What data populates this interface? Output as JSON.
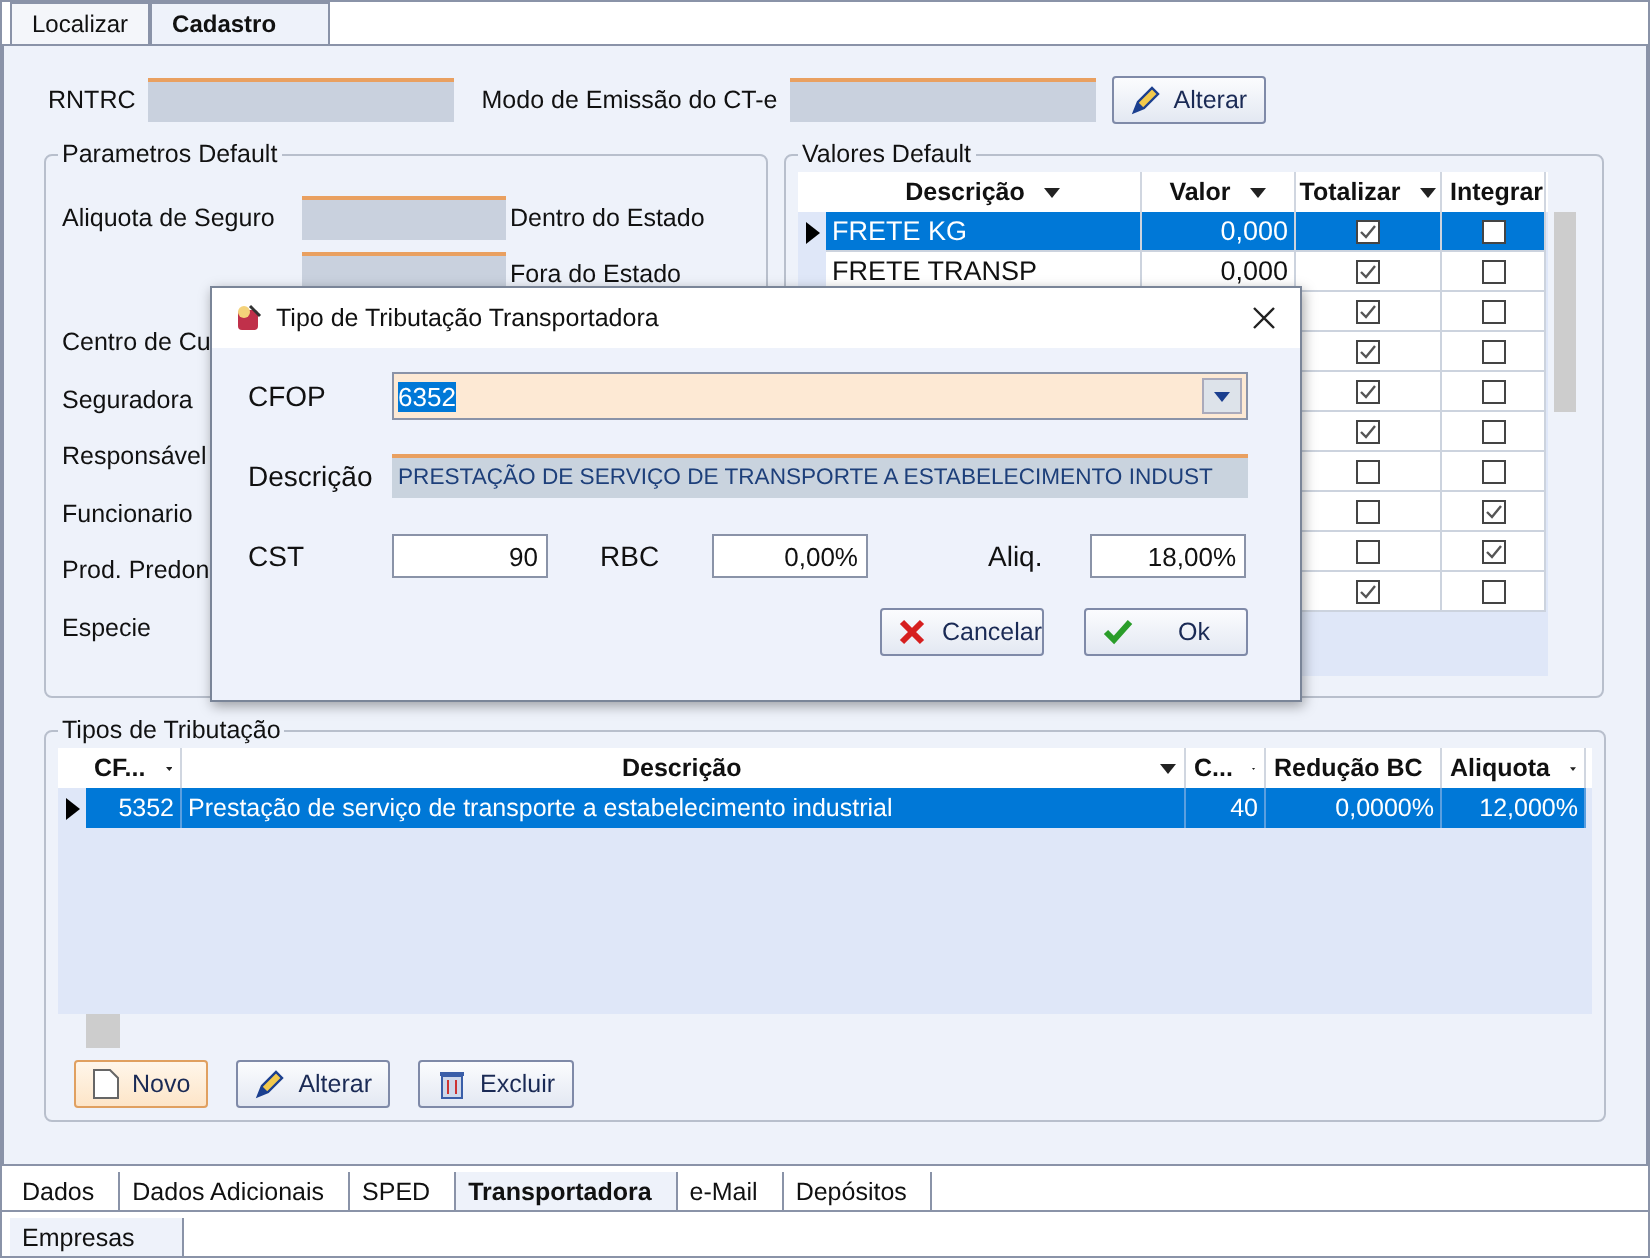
{
  "top_tabs": [
    {
      "label": "Localizar",
      "selected": false
    },
    {
      "label": "Cadastro",
      "selected": true
    }
  ],
  "header": {
    "rntrc_label": "RNTRC",
    "modo_label": "Modo de Emissão do CT-e",
    "alterar_button": "Alterar"
  },
  "parametros_default": {
    "title": "Parametros Default",
    "aliquota_label": "Aliquota de Seguro",
    "dentro_label": "Dentro do Estado",
    "fora_label": "Fora do Estado",
    "labels": [
      "Centro de Cu",
      "Seguradora",
      "Responsável",
      "Funcionario",
      "Prod. Predon",
      "Especie"
    ]
  },
  "valores_default": {
    "title": "Valores Default",
    "columns": [
      "Descrição",
      "Valor",
      "Totalizar",
      "Integrar"
    ],
    "rows": [
      {
        "descricao": "FRETE KG",
        "valor": "0,000",
        "totalizar": true,
        "integrar": false,
        "selected": true
      },
      {
        "descricao": "FRETE TRANSP",
        "valor": "0,000",
        "totalizar": true,
        "integrar": false,
        "selected": false
      },
      {
        "totalizar": true,
        "integrar": false,
        "selected": false
      },
      {
        "totalizar": true,
        "integrar": false,
        "selected": false
      },
      {
        "totalizar": true,
        "integrar": false,
        "selected": false
      },
      {
        "totalizar": true,
        "integrar": false,
        "selected": false
      },
      {
        "totalizar": false,
        "integrar": false,
        "selected": false
      },
      {
        "totalizar": false,
        "integrar": true,
        "selected": false
      },
      {
        "totalizar": false,
        "integrar": true,
        "selected": false
      },
      {
        "totalizar": true,
        "integrar": false,
        "selected": false
      }
    ]
  },
  "tipos_tributacao": {
    "title": "Tipos de Tributação",
    "columns": [
      "CF...",
      "Descrição",
      "C...",
      "Redução BC",
      "Aliquota"
    ],
    "rows": [
      {
        "cfop": "5352",
        "descricao": "Prestação de serviço de transporte a estabelecimento industrial",
        "c": "40",
        "reducao": "0,0000%",
        "aliquota": "12,000%",
        "selected": true
      }
    ],
    "buttons": [
      {
        "kind": "new",
        "label": "Novo"
      },
      {
        "kind": "edit",
        "label": "Alterar"
      },
      {
        "kind": "delete",
        "label": "Excluir"
      }
    ]
  },
  "bottom_tabs": [
    {
      "label": "Dados",
      "selected": false
    },
    {
      "label": "Dados Adicionais",
      "selected": false
    },
    {
      "label": "SPED",
      "selected": false
    },
    {
      "label": "Transportadora",
      "selected": true
    },
    {
      "label": "e-Mail",
      "selected": false
    },
    {
      "label": "Depósitos",
      "selected": false
    }
  ],
  "footer_tabs": [
    {
      "label": "Empresas",
      "selected": true
    }
  ],
  "dialog": {
    "title": "Tipo de Tributação Transportadora",
    "cfop_label": "CFOP",
    "cfop_value": "6352",
    "descricao_label": "Descrição",
    "descricao_value": "PRESTAÇÃO DE SERVIÇO DE TRANSPORTE A ESTABELECIMENTO INDUST",
    "cst_label": "CST",
    "cst_value": "90",
    "rbc_label": "RBC",
    "rbc_value": "0,00%",
    "aliq_label": "Aliq.",
    "aliq_value": "18,00%",
    "cancel_button": "Cancelar",
    "ok_button": "Ok"
  }
}
